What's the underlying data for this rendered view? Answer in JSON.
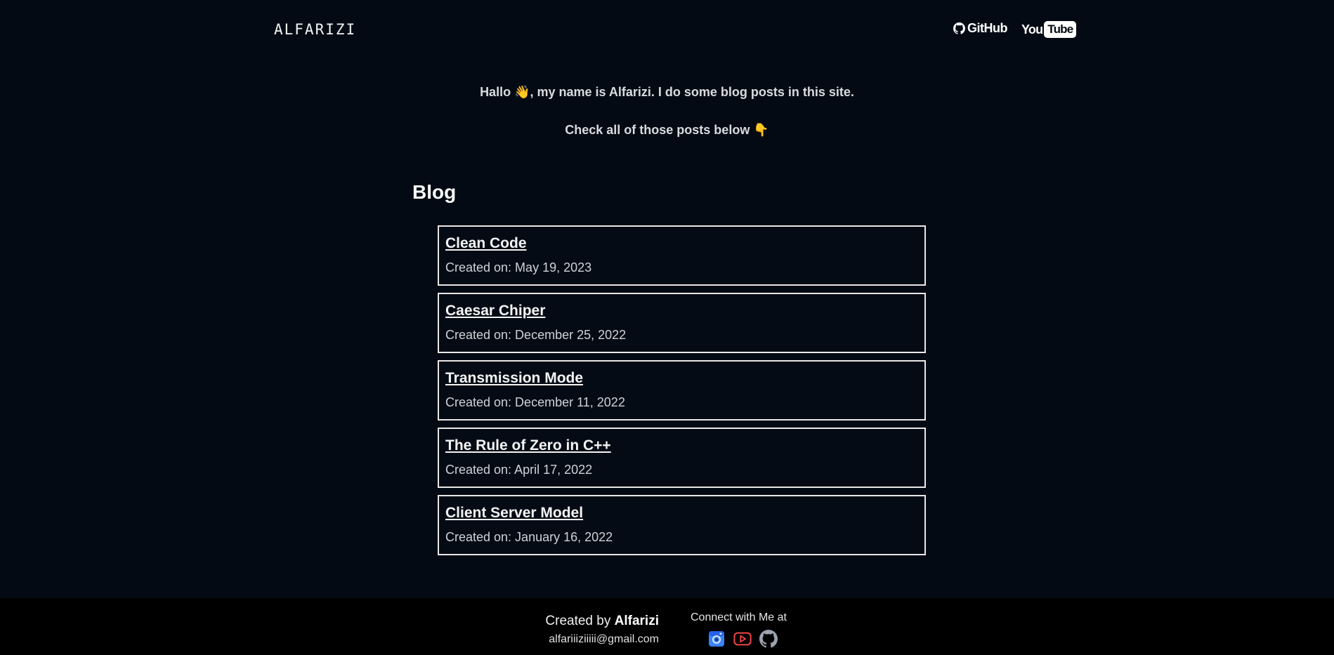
{
  "header": {
    "logo": "ALFARIZI",
    "nav": {
      "github_label": "GitHub",
      "youtube_you": "You",
      "youtube_tube": "Tube"
    }
  },
  "intro": {
    "line1": "Hallo 👋, my name is Alfarizi. I do some blog posts in this site.",
    "line2": "Check all of those posts below 👇"
  },
  "blog": {
    "heading": "Blog",
    "posts": [
      {
        "title": "Clean Code",
        "date": "Created on: May 19, 2023"
      },
      {
        "title": "Caesar Chiper",
        "date": "Created on: December 25, 2022"
      },
      {
        "title": "Transmission Mode",
        "date": "Created on: December 11, 2022"
      },
      {
        "title": "The Rule of Zero in C++",
        "date": "Created on: April 17, 2022"
      },
      {
        "title": "Client Server Model",
        "date": "Created on: January 16, 2022"
      }
    ]
  },
  "footer": {
    "created_prefix": "Created by",
    "created_name": "Alfarizi",
    "email": "alfariiiziiiii@gmail.com",
    "connect_label": "Connect with Me at",
    "social_icons": [
      "instagram-icon",
      "youtube-icon",
      "github-icon"
    ],
    "colors": {
      "instagram": "#3b82f6",
      "youtube": "#ef4444",
      "github": "#9ca3af"
    }
  },
  "colors": {
    "background": "#040a13",
    "footer_bg": "#000000",
    "text": "#e6e8ee",
    "border": "#e8e8e8"
  }
}
